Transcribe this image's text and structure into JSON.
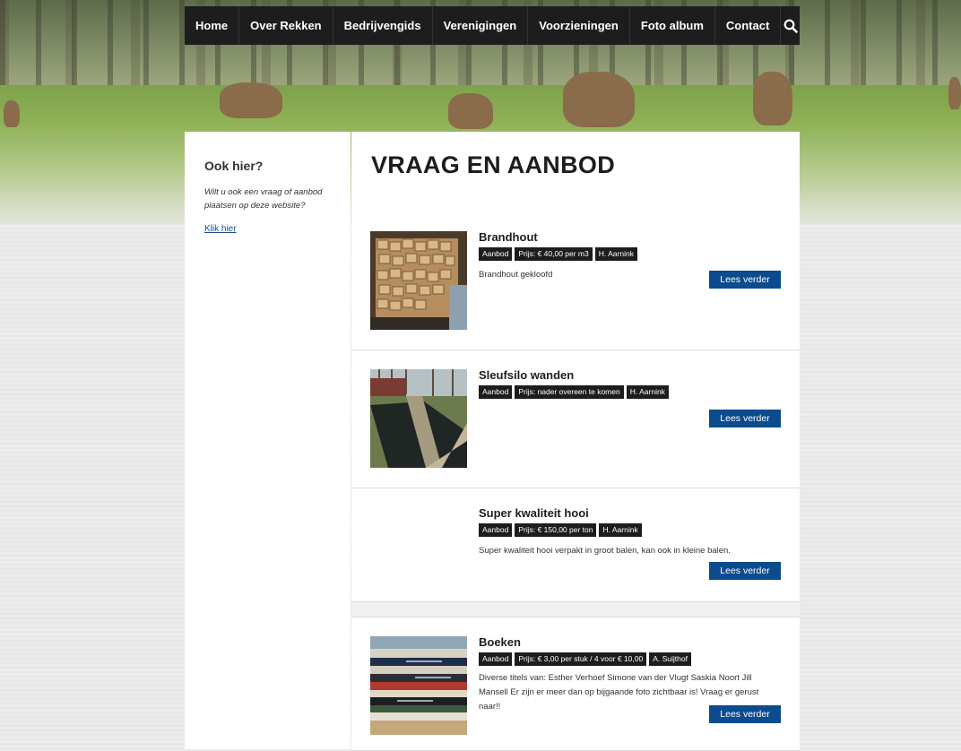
{
  "nav": {
    "items": [
      "Home",
      "Over Rekken",
      "Bedrijvengids",
      "Verenigingen",
      "Voorzieningen",
      "Foto album",
      "Contact"
    ],
    "search_icon": "search-icon"
  },
  "sidebar": {
    "title": "Ook hier?",
    "text": "Wilt u ook een vraag of aanbod plaatsen op deze website?",
    "link": "Klik hier"
  },
  "main": {
    "title": "VRAAG EN AANBOD",
    "button_label": "Lees verder",
    "listings": [
      {
        "title": "Brandhout",
        "type": "Aanbod",
        "price": "Prijs: € 40,00 per m3",
        "author": "H. Aarnink",
        "description": "Brandhout gekloofd"
      },
      {
        "title": "Sleufsilo wanden",
        "type": "Aanbod",
        "price": "Prijs: nader overeen te komen",
        "author": "H. Aarnink",
        "description": ""
      },
      {
        "title": "Super kwaliteit hooi",
        "type": "Aanbod",
        "price": "Prijs: € 150,00 per ton",
        "author": "H. Aarnink",
        "description": "Super kwaliteit hooi verpakt in groot balen, kan ook in kleine balen."
      },
      {
        "title": "Boeken",
        "type": "Aanbod",
        "price": "Prijs: € 3,00 per stuk / 4 voor € 10,00",
        "author": "A. Suijthof",
        "description": "Diverse titels van: Esther Verhoef Simone van der Vlugt Saskia Noort Jill Mansell Er zijn er meer dan op bijgaande foto zichtbaar is! Vraag er gerust naar!!"
      }
    ]
  },
  "colors": {
    "nav_bg": "#1d1d1d",
    "button_bg": "#0c4b8e",
    "link": "#1a4d8f"
  }
}
